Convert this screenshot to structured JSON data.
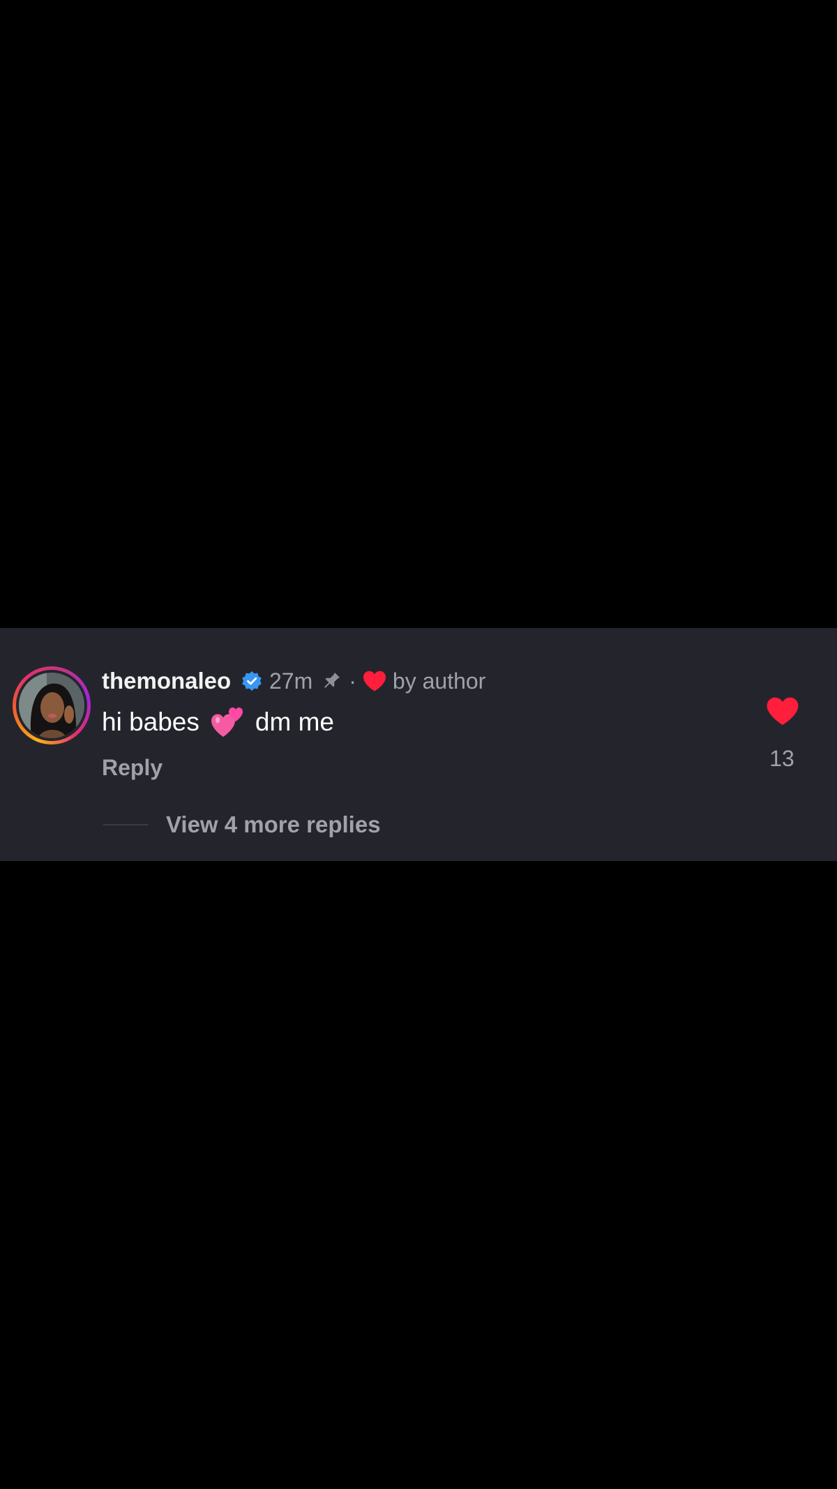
{
  "comment": {
    "username": "themonaleo",
    "time": "27m",
    "separator": "·",
    "liked_by": "by author",
    "text_before_emoji": "hi babes",
    "text_after_emoji": "dm me",
    "emoji": "two-hearts-icon",
    "reply_label": "Reply",
    "like_count": "13",
    "view_replies_label": "View 4 more replies"
  },
  "colors": {
    "background": "#000000",
    "card": "#24252c",
    "heart": "#ff1e3c",
    "verified": "#3897f0",
    "muted_text": "#a0a2aa"
  },
  "icons": {
    "verified": "verified-badge-icon",
    "pin": "pin-icon",
    "small_heart": "heart-icon",
    "like": "heart-filled-icon"
  }
}
